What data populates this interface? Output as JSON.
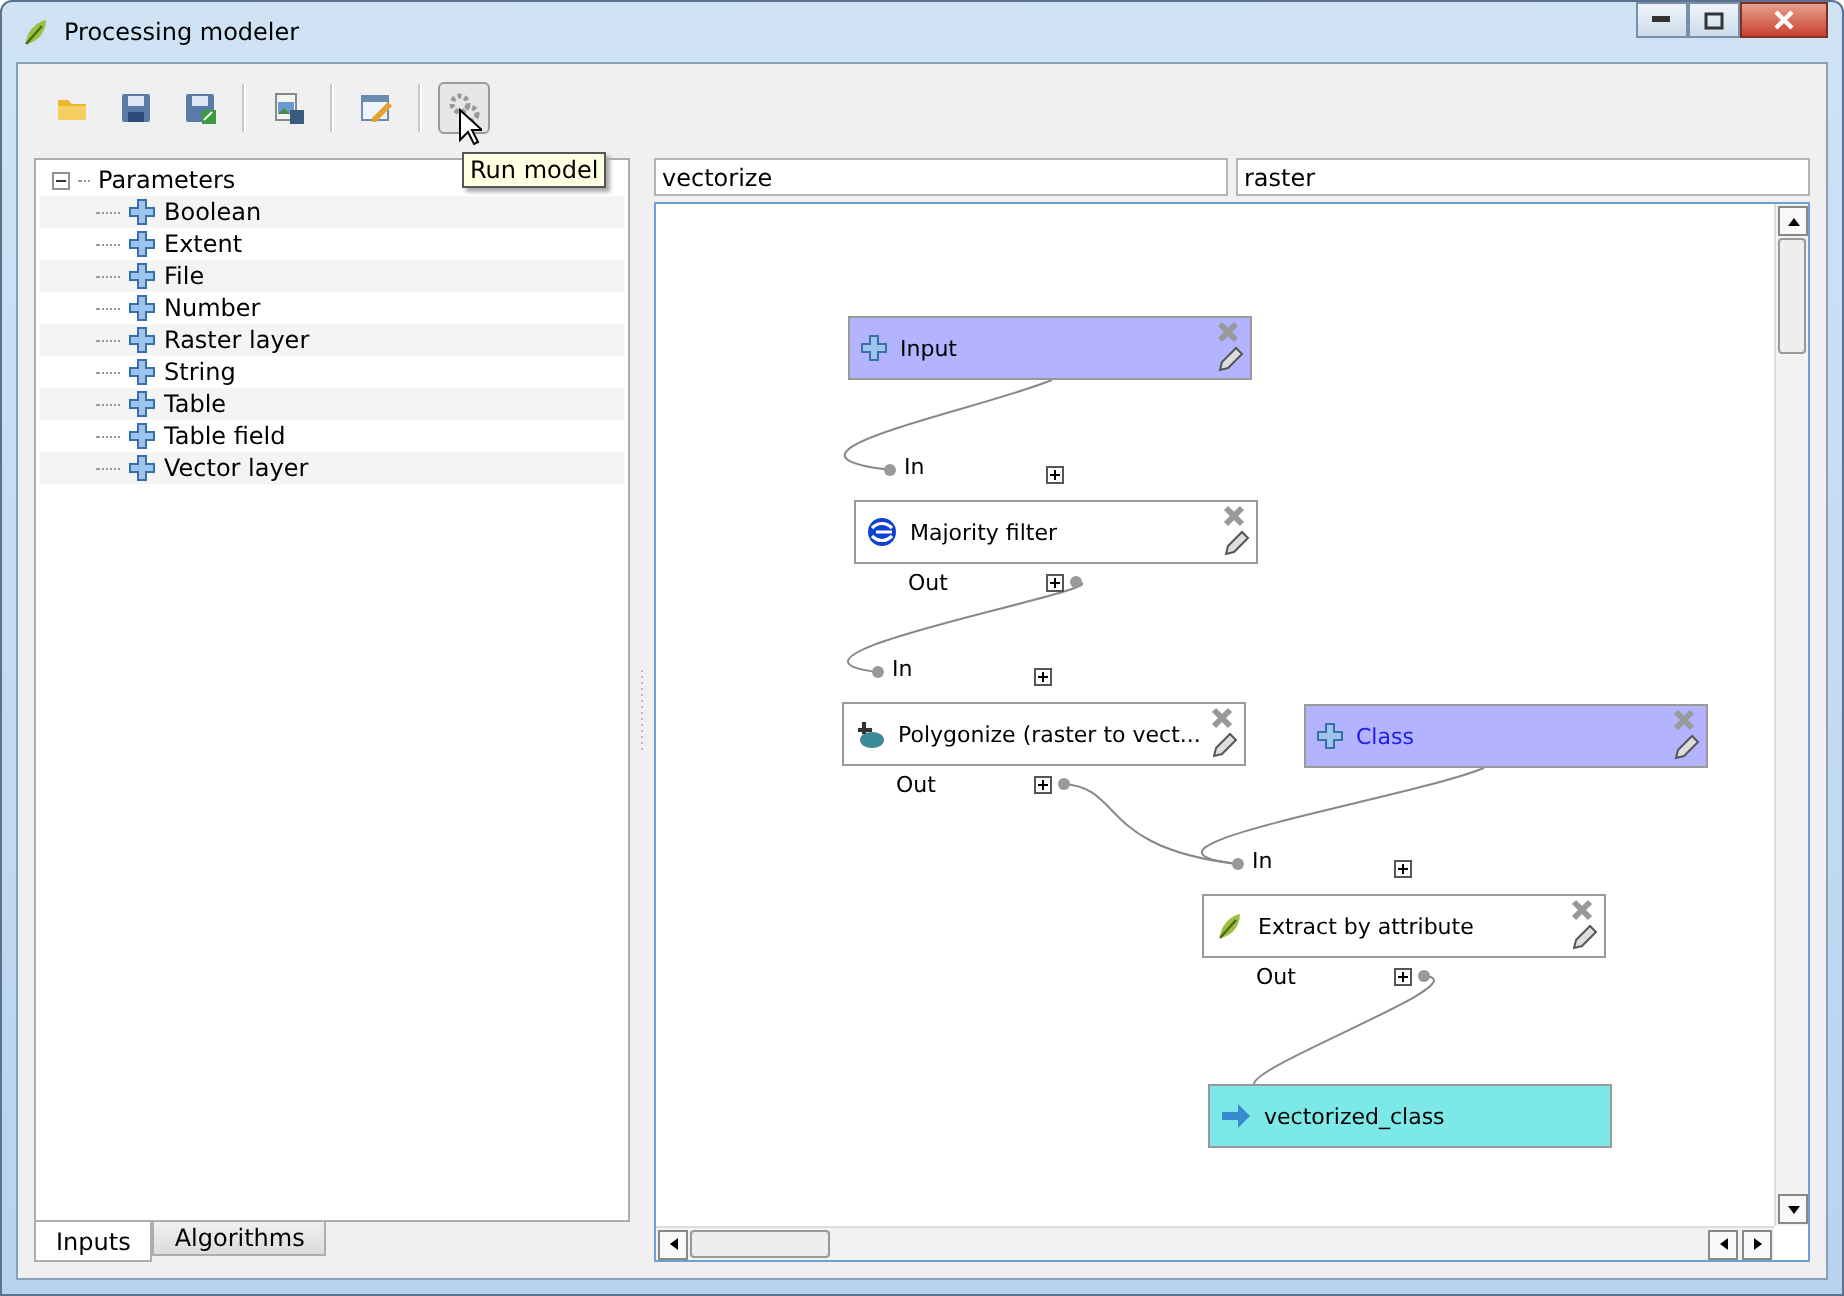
{
  "window": {
    "title": "Processing modeler"
  },
  "toolbar": {
    "buttons": [
      {
        "kind": "open",
        "pressed": false
      },
      {
        "kind": "save",
        "pressed": false
      },
      {
        "kind": "save-as",
        "pressed": false
      },
      {
        "kind": "export-image",
        "pressed": false
      },
      {
        "kind": "edit-help",
        "pressed": false
      },
      {
        "kind": "run",
        "pressed": true
      }
    ],
    "tooltip": "Run model"
  },
  "sidebar": {
    "tree": {
      "label": "Parameters",
      "expanded": true,
      "children": [
        {
          "label": "Boolean"
        },
        {
          "label": "Extent"
        },
        {
          "label": "File"
        },
        {
          "label": "Number"
        },
        {
          "label": "Raster layer"
        },
        {
          "label": "String"
        },
        {
          "label": "Table"
        },
        {
          "label": "Table field"
        },
        {
          "label": "Vector layer"
        }
      ]
    },
    "tabs": [
      {
        "label": "Inputs",
        "selected": true
      },
      {
        "label": "Algorithms",
        "selected": false
      }
    ]
  },
  "model": {
    "name_field": {
      "value": "vectorize"
    },
    "group_field": {
      "value": "raster"
    }
  },
  "canvas": {
    "nodes": [
      {
        "kind": "input",
        "label": "Input",
        "highlighted": false
      },
      {
        "kind": "algorithm",
        "label": "Majority filter",
        "inputs": [
          "In"
        ],
        "outputs": [
          "Out"
        ],
        "highlighted": false
      },
      {
        "kind": "algorithm",
        "label": "Polygonize (raster to vect...",
        "inputs": [
          "In"
        ],
        "outputs": [
          "Out"
        ],
        "highlighted": false
      },
      {
        "kind": "input",
        "label": "Class",
        "highlighted": true
      },
      {
        "kind": "algorithm",
        "label": "Extract by attribute",
        "inputs": [
          "In"
        ],
        "outputs": [
          "Out"
        ],
        "highlighted": false
      },
      {
        "kind": "output",
        "label": "vectorized_class",
        "highlighted": false
      }
    ]
  }
}
